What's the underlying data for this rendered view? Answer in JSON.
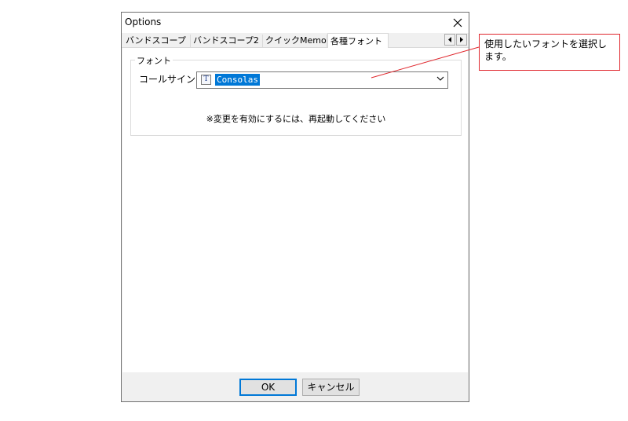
{
  "dialog": {
    "title": "Options",
    "close_icon": "close-icon"
  },
  "tabs": [
    {
      "label": "バンドスコープ"
    },
    {
      "label": "バンドスコープ2"
    },
    {
      "label": "クイックMemo"
    },
    {
      "label": "各種フォント",
      "active": true
    }
  ],
  "tab_scroll": {
    "left_icon": "triangle-left-icon",
    "right_icon": "triangle-right-icon"
  },
  "font_group": {
    "title": "フォント",
    "label": "コールサイン",
    "font_icon": "truetype-font-icon",
    "selected_value": "Consolas",
    "note": "※変更を有効にするには、再起動してください"
  },
  "buttons": {
    "ok": "OK",
    "cancel": "キャンセル"
  },
  "callout": {
    "text": "使用したいフォントを選択します。",
    "border_color": "#e0282e"
  },
  "colors": {
    "selection": "#0078d7",
    "dialog_bg": "#f0f0f0"
  }
}
